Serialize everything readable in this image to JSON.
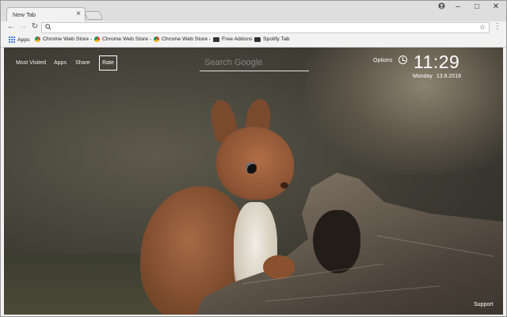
{
  "window": {
    "tab_title": "New Tab",
    "tab_close": "×",
    "profile_icon": "user-icon",
    "minimize": "–",
    "maximize": "□",
    "close": "✕"
  },
  "toolbar": {
    "back": "←",
    "forward": "→",
    "reload": "↻",
    "search_glyph": "🔍",
    "address_value": "",
    "star": "☆",
    "menu": "⋮"
  },
  "bookmarks": [
    {
      "label": "Apps",
      "icon": "apps-icon"
    },
    {
      "label": "Chrome Web Store -",
      "icon": "chrome-store-icon"
    },
    {
      "label": "Chrome Web Store -",
      "icon": "chrome-store-icon"
    },
    {
      "label": "Chrome Web Store -",
      "icon": "chrome-store-icon"
    },
    {
      "label": "Free Addons",
      "icon": "addon-icon"
    },
    {
      "label": "Spotify Tab",
      "icon": "addon-icon"
    }
  ],
  "newtab": {
    "nav": [
      "Most Visited",
      "Apps",
      "Share",
      "Rate"
    ],
    "search_placeholder": "Search Google",
    "options_label": "Options",
    "time": "11:29",
    "day": "Monday",
    "date": "13.8.2018",
    "support_label": "Support"
  },
  "colors": {
    "chrome_frame": "#dedede",
    "overlay_text": "#ffffff"
  }
}
